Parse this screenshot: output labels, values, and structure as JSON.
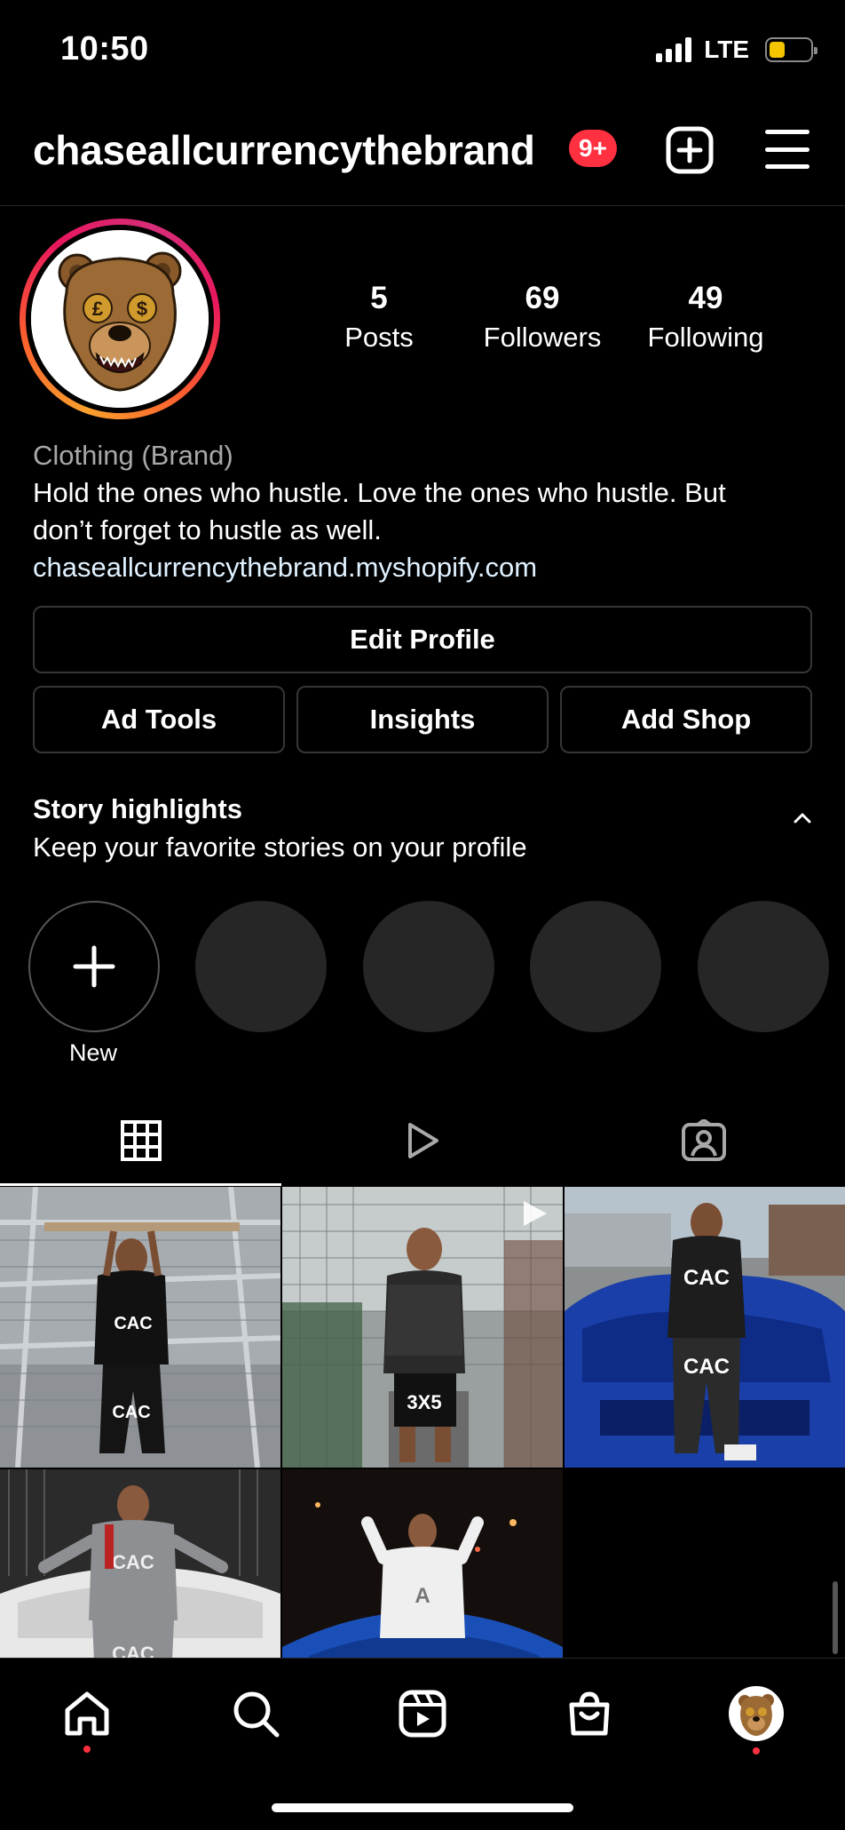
{
  "status_bar": {
    "time": "10:50",
    "network": "LTE"
  },
  "header": {
    "username": "chaseallcurrencythebrand",
    "notification_badge": "9+"
  },
  "profile": {
    "stats": [
      {
        "value": "5",
        "label": "Posts"
      },
      {
        "value": "69",
        "label": "Followers"
      },
      {
        "value": "49",
        "label": "Following"
      }
    ],
    "category": "Clothing (Brand)",
    "bio_line1": "Hold the ones who hustle. Love the ones who hustle. But",
    "bio_line2": "don’t forget to hustle as well.",
    "link": "chaseallcurrencythebrand.myshopify.com"
  },
  "buttons": {
    "edit_profile": "Edit Profile",
    "ad_tools": "Ad Tools",
    "insights": "Insights",
    "add_shop": "Add Shop"
  },
  "highlights": {
    "title": "Story highlights",
    "subtitle": "Keep your favorite stories on your profile",
    "new_label": "New"
  },
  "tabs": [
    "grid-icon",
    "reels-icon",
    "tagged-icon"
  ],
  "posts": [
    {
      "caption_visible": "CAC",
      "type": "photo"
    },
    {
      "caption_visible": "",
      "type": "reel"
    },
    {
      "caption_visible": "CAC",
      "type": "photo"
    },
    {
      "caption_visible": "CAC",
      "type": "photo"
    },
    {
      "caption_visible": "",
      "type": "photo"
    }
  ],
  "bottom_nav": [
    "home-icon",
    "search-icon",
    "reels-icon",
    "shop-icon",
    "profile-avatar"
  ],
  "colors": {
    "background": "#000000",
    "badge": "#ff3040",
    "button_border": "#363636",
    "highlight_fill": "#262626",
    "link": "#e0f1ff",
    "muted": "#a8a8a8",
    "battery": "#f5c400"
  }
}
